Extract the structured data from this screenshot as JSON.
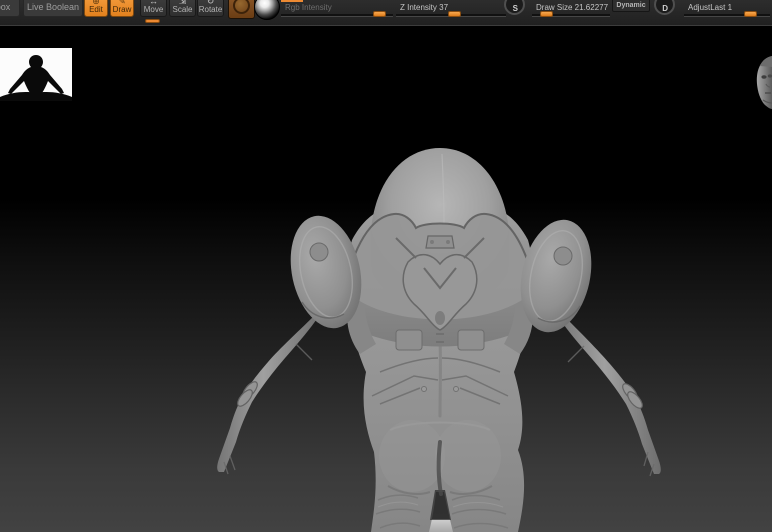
{
  "toolbar": {
    "lightbox": {
      "label": "box"
    },
    "live_boolean": {
      "label": "Live Boolean"
    },
    "edit": {
      "label": "Edit"
    },
    "draw": {
      "label": "Draw"
    },
    "move": {
      "label": "Move"
    },
    "scale": {
      "label": "Scale"
    },
    "rotate": {
      "label": "Rotate"
    },
    "rgb_intensity": {
      "label": "Rgb Intensity",
      "disabled": true
    },
    "z_intensity": {
      "label": "Z Intensity 37",
      "value": 37
    },
    "draw_size": {
      "label": "Draw Size 21.62277",
      "value": 21.62277
    },
    "dynamic": {
      "label": "Dynamic"
    },
    "adjust_last": {
      "label": "AdjustLast 1",
      "value": 1
    },
    "shortcut_s": "S",
    "shortcut_d": "D",
    "icons": {
      "edit": "⊕",
      "draw": "✎",
      "move": "↔",
      "scale": "⇲",
      "rotate": "↻",
      "shortcut_arrow": "↷"
    }
  },
  "colors": {
    "accent_orange": "#ED8A33",
    "toolbar_bg": "#2B2B2B",
    "button_orange": "#EE8E33",
    "canvas_top": "#000000",
    "canvas_bottom": "#424242",
    "model_gray": "#909090",
    "thumbnail_bg": "#FCFCFC"
  }
}
